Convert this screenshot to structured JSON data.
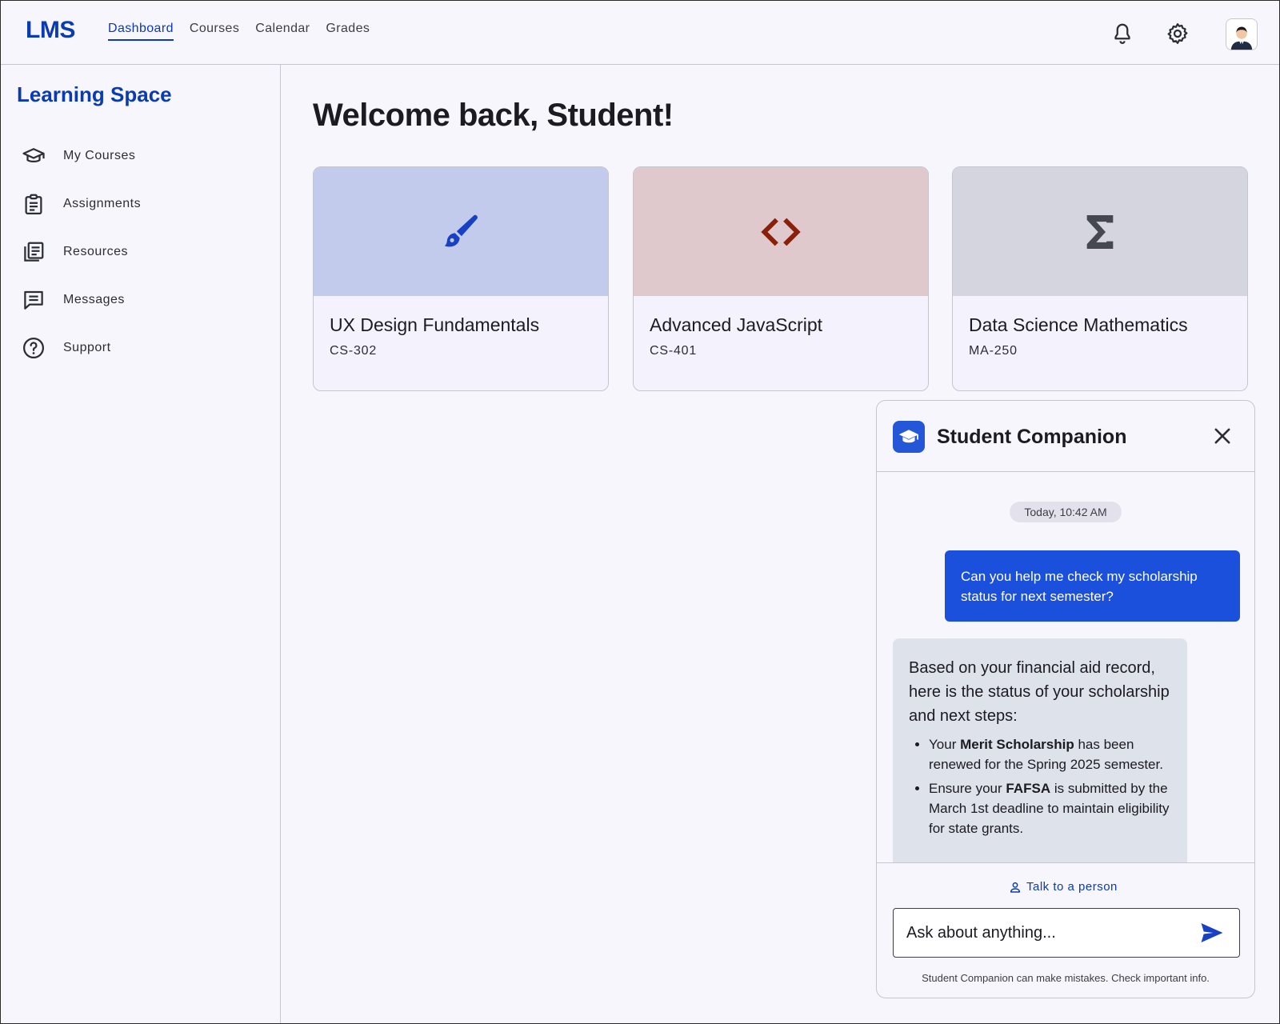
{
  "header": {
    "logo": "LMS",
    "nav": [
      {
        "label": "Dashboard",
        "active": true
      },
      {
        "label": "Courses",
        "active": false
      },
      {
        "label": "Calendar",
        "active": false
      },
      {
        "label": "Grades",
        "active": false
      }
    ],
    "icons": [
      "bell-icon",
      "gear-icon",
      "avatar"
    ]
  },
  "sidebar": {
    "title": "Learning Space",
    "items": [
      {
        "label": "My Courses",
        "icon": "graduation-cap-icon"
      },
      {
        "label": "Assignments",
        "icon": "clipboard-icon"
      },
      {
        "label": "Resources",
        "icon": "library-icon"
      },
      {
        "label": "Messages",
        "icon": "message-icon"
      },
      {
        "label": "Support",
        "icon": "help-icon"
      }
    ]
  },
  "main": {
    "welcome": "Welcome back, Student!",
    "courses": [
      {
        "name": "UX Design Fundamentals",
        "code": "CS-302",
        "icon": "brush-icon",
        "color": "#c2cbec"
      },
      {
        "name": "Advanced JavaScript",
        "code": "CS-401",
        "icon": "code-icon",
        "color": "#dfc9cc"
      },
      {
        "name": "Data Science Mathematics",
        "code": "MA-250",
        "icon": "sigma-icon",
        "color": "#d5d5e0"
      }
    ]
  },
  "chat": {
    "title": "Student Companion",
    "timestamp": "Today, 10:42 AM",
    "user_message": "Can you help me check my scholarship status for next semester?",
    "bot": {
      "intro": "Based on your financial aid record, here is the status of your scholarship and next steps:",
      "bullet1": {
        "pre": "Your ",
        "bold": "Merit Scholarship",
        "post": " has been renewed for the Spring 2025 semester."
      },
      "bullet2": {
        "pre": "Ensure your ",
        "bold": "FAFSA",
        "post": " is submitted by the March 1st deadline to maintain eligibility for state grants."
      }
    },
    "talk_link": "Talk to a person",
    "input_placeholder": "Ask about anything...",
    "disclaimer": "Student Companion can make mistakes. Check important info."
  },
  "colors": {
    "accent": "#0a3bb2",
    "user_bubble": "#1b50dc",
    "bot_bubble": "#dde2eb"
  }
}
